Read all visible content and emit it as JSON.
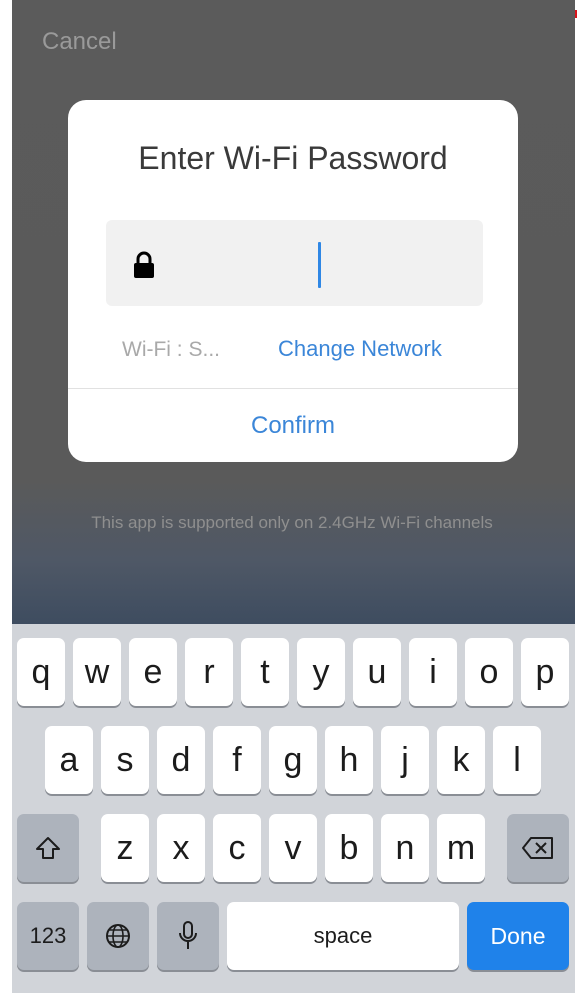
{
  "header": {
    "cancel_label": "Cancel"
  },
  "dialog": {
    "title": "Enter Wi-Fi Password",
    "password_value": "",
    "wifi_label": "Wi-Fi : S...",
    "change_network_label": "Change Network",
    "confirm_label": "Confirm"
  },
  "note": "This app is supported only on 2.4GHz Wi-Fi channels",
  "keyboard": {
    "row1": [
      "q",
      "w",
      "e",
      "r",
      "t",
      "y",
      "u",
      "i",
      "o",
      "p"
    ],
    "row2": [
      "a",
      "s",
      "d",
      "f",
      "g",
      "h",
      "j",
      "k",
      "l"
    ],
    "row3": [
      "z",
      "x",
      "c",
      "v",
      "b",
      "n",
      "m"
    ],
    "numbers_label": "123",
    "space_label": "space",
    "done_label": "Done"
  },
  "colors": {
    "accent": "#3b86d8",
    "done_key": "#1f82ea",
    "red_line": "#d8141c"
  }
}
